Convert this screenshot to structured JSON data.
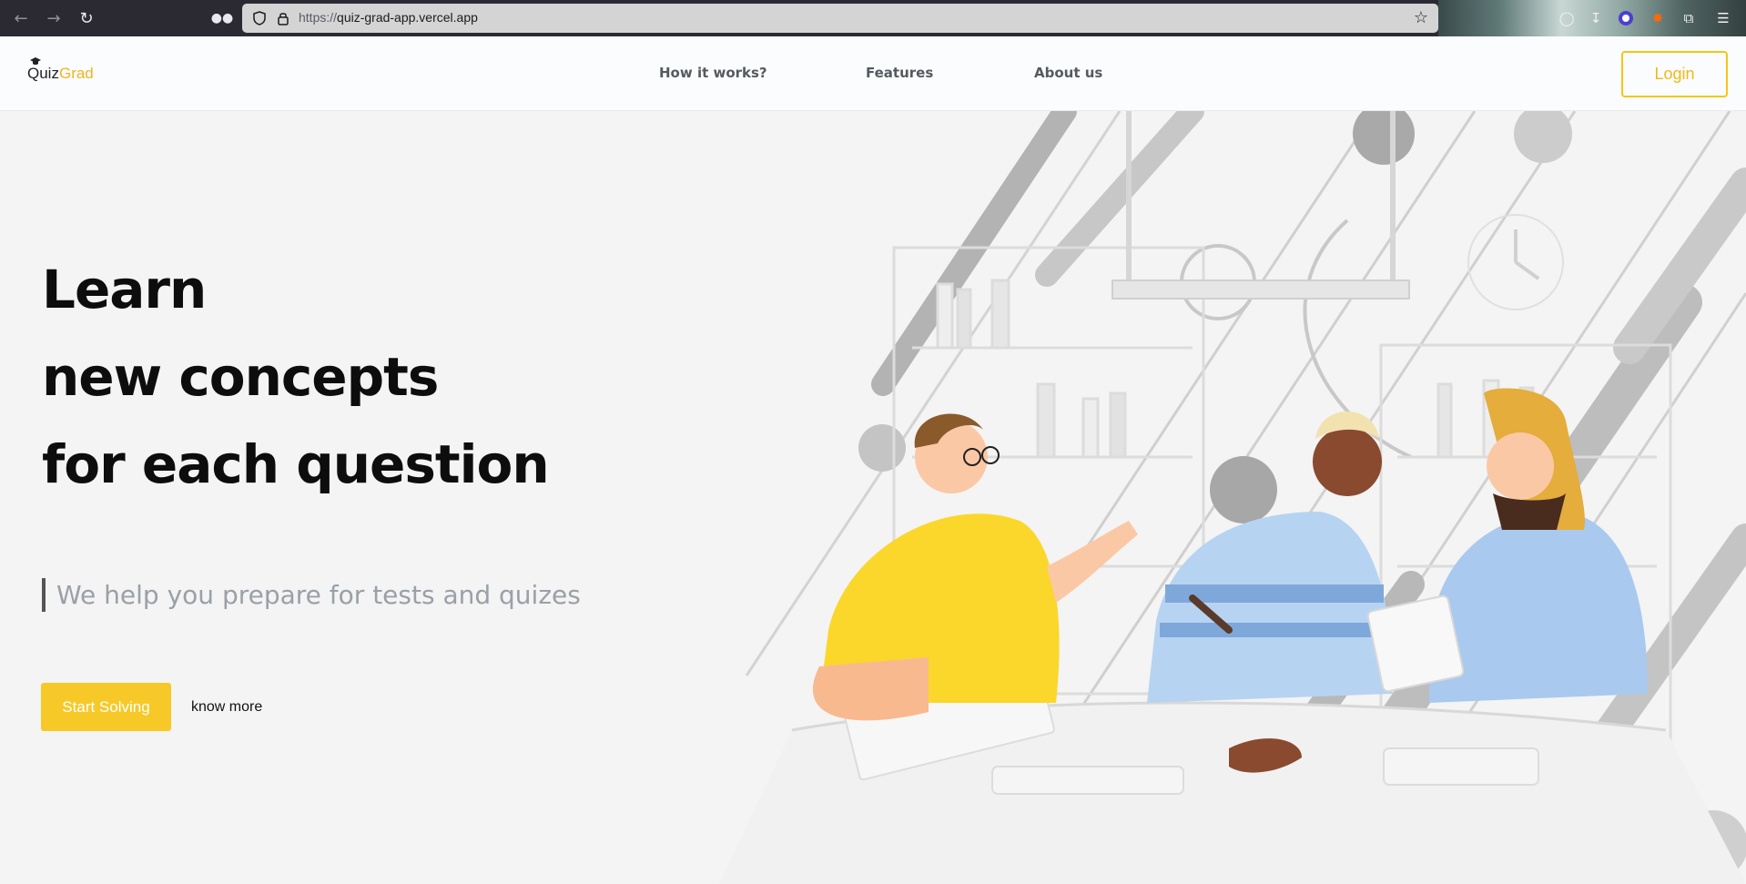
{
  "browser": {
    "url_protocol": "https://",
    "url_host": "quiz-grad-app.vercel.app"
  },
  "header": {
    "logo_part1": "Quiz",
    "logo_part2": "Grad",
    "nav": [
      {
        "label": "How it works?"
      },
      {
        "label": "Features"
      },
      {
        "label": "About us"
      }
    ],
    "login_label": "Login"
  },
  "hero": {
    "headline": [
      "Learn",
      "new concepts",
      "for each question"
    ],
    "subheading": "We help you prepare for tests and quizes",
    "primary_cta": "Start Solving",
    "secondary_cta": "know more"
  },
  "colors": {
    "accent": "#f7c928",
    "login_border": "#f5c518",
    "background": "#f3f4f3"
  }
}
